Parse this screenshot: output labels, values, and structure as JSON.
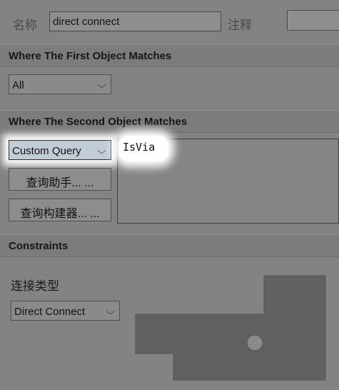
{
  "top": {
    "name_label": "名称",
    "name_value": "direct connect",
    "comment_label": "注释",
    "comment_value": ""
  },
  "first": {
    "header": "Where The First Object Matches",
    "selected": "All"
  },
  "second": {
    "header": "Where The Second Object Matches",
    "selected": "Custom Query",
    "query_text": "IsVia",
    "query_helper_button": "查询助手... ...",
    "query_builder_button": "查询构建器... ..."
  },
  "constraints": {
    "header": "Constraints",
    "connection_type_label": "连接类型",
    "connection_type_value": "Direct Connect"
  }
}
